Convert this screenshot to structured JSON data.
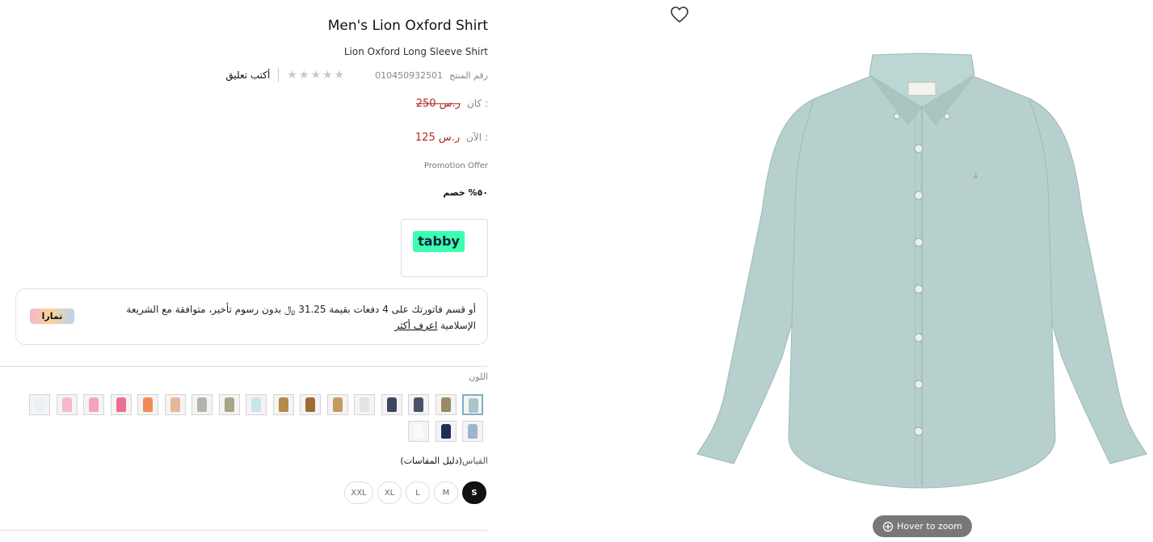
{
  "product": {
    "title": "Men's Lion Oxford Shirt",
    "subtitle": "Lion Oxford Long Sleeve Shirt",
    "sku_label": "رقم المنتج",
    "sku": "010450932501",
    "rating": "★★★★★",
    "rating_value": 0,
    "write_review": "أكتب تعليق"
  },
  "price": {
    "was_label": "كان :",
    "was_value": "250 ر.س",
    "now_label": "الآن :",
    "now_value": "125 ر.س",
    "promo": "Promotion Offer",
    "discount": "٥٠% خصم"
  },
  "tabby": {
    "logo": "tabby"
  },
  "tamara": {
    "text": "أو قسم فاتورتك على 4 دفعات بقيمة 31.25 ﷼ بدون رسوم تأخير، متوافقة مع الشريعة الإسلامية",
    "link": "اعرف أكثر",
    "logo": "تمارا"
  },
  "color": {
    "label": "اللون",
    "swatches": [
      {
        "color": "#a9c6c9",
        "selected": true
      },
      {
        "color": "#9a8a66"
      },
      {
        "color": "#4a5468"
      },
      {
        "color": "#3d4660"
      },
      {
        "color": "#e3e3e6"
      },
      {
        "color": "#c49a62"
      },
      {
        "color": "#a06a34"
      },
      {
        "color": "#b68a4a"
      },
      {
        "color": "#c9e5ea"
      },
      {
        "color": "#a8a58a"
      },
      {
        "color": "#b5b3aa"
      },
      {
        "color": "#e7b59a"
      },
      {
        "color": "#f38a52"
      },
      {
        "color": "#ef6d8f"
      },
      {
        "color": "#f4a1c4"
      },
      {
        "color": "#f6b7cf"
      },
      {
        "color": "#e9f1f6"
      },
      {
        "color": "#9db3cf"
      },
      {
        "color": "#1f2f54"
      },
      {
        "color": "#fafafa"
      }
    ]
  },
  "size": {
    "label": "القياس",
    "guide": "(دليل المقاسات)",
    "options": [
      "S",
      "M",
      "L",
      "XL",
      "XXL"
    ],
    "selected": "S"
  },
  "image": {
    "zoom_hint": "Hover to zoom",
    "shirt_color": "#b6d0cd"
  }
}
